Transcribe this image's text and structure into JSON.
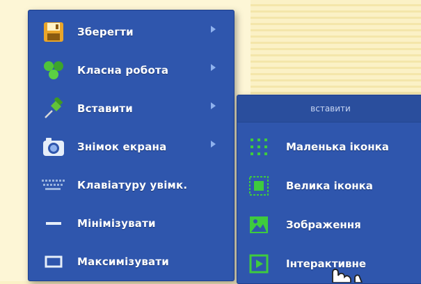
{
  "main_menu": {
    "items": [
      {
        "label": "Зберегти",
        "icon": "floppy-disk-icon",
        "has_submenu": true
      },
      {
        "label": "Класна робота",
        "icon": "green-dots-icon",
        "has_submenu": true
      },
      {
        "label": "Вставити",
        "icon": "pushpin-icon",
        "has_submenu": true
      },
      {
        "label": "Знімок екрана",
        "icon": "camera-icon",
        "has_submenu": true
      },
      {
        "label": "Клавіатуру увімк.",
        "icon": "keyboard-icon",
        "has_submenu": false
      },
      {
        "label": "Мінімізувати",
        "icon": "minimize-icon",
        "has_submenu": false
      },
      {
        "label": "Максимізувати",
        "icon": "maximize-icon",
        "has_submenu": false
      }
    ]
  },
  "sub_menu": {
    "header": "вставити",
    "items": [
      {
        "label": "Маленька іконка",
        "icon": "small-icon-grid-icon"
      },
      {
        "label": "Велика іконка",
        "icon": "large-icon-icon"
      },
      {
        "label": "Зображення",
        "icon": "image-icon"
      },
      {
        "label": "Інтерактивне",
        "icon": "interactive-play-icon"
      }
    ]
  },
  "colors": {
    "menu_bg": "#2f56ad",
    "accent_green": "#3ecb3e",
    "arrow": "#8fb2ee"
  }
}
